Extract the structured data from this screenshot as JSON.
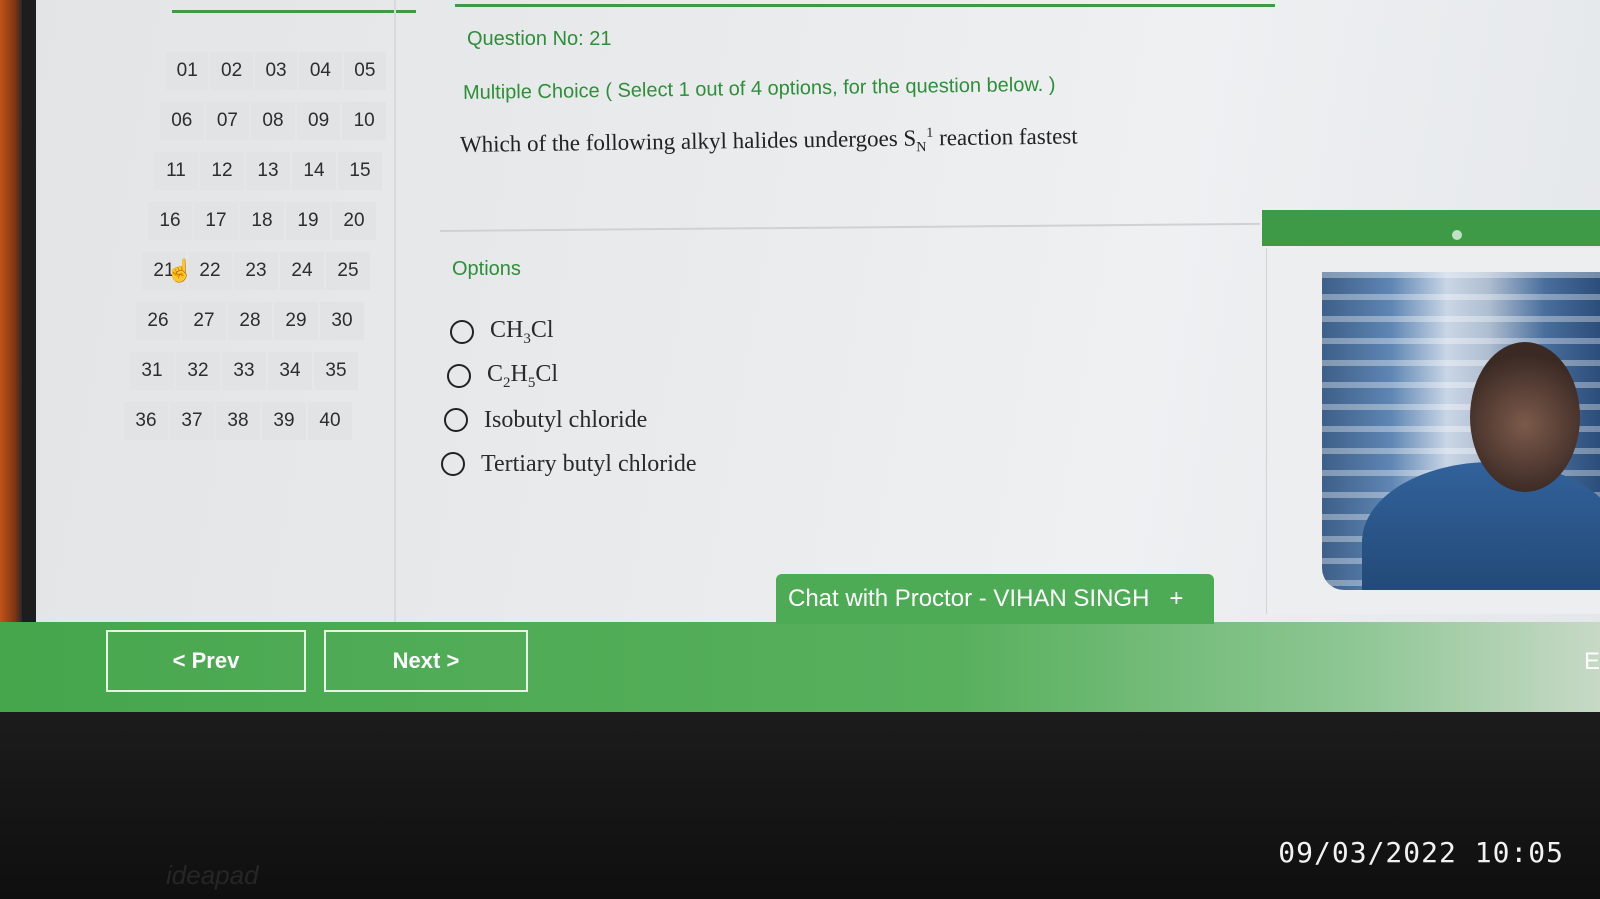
{
  "palette": {
    "rows": [
      [
        "01",
        "02",
        "03",
        "04",
        "05"
      ],
      [
        "06",
        "07",
        "08",
        "09",
        "10"
      ],
      [
        "11",
        "12",
        "13",
        "14",
        "15"
      ],
      [
        "16",
        "17",
        "18",
        "19",
        "20"
      ],
      [
        "21",
        "22",
        "23",
        "24",
        "25"
      ],
      [
        "26",
        "27",
        "28",
        "29",
        "30"
      ],
      [
        "31",
        "32",
        "33",
        "34",
        "35"
      ],
      [
        "36",
        "37",
        "38",
        "39",
        "40"
      ]
    ],
    "current": "21"
  },
  "question": {
    "number_label": "Question No: 21",
    "type_instruction": "Multiple Choice ( Select 1 out of 4 options, for the question below. )",
    "text_before": "Which of the following alkyl halides undergoes S",
    "text_sub": "N",
    "text_sup": "1",
    "text_after": " reaction fastest"
  },
  "options": {
    "label": "Options",
    "o1": {
      "a": "CH",
      "sub": "3",
      "b": "Cl"
    },
    "o2": {
      "a": "C",
      "sub1": "2",
      "b": "H",
      "sub2": "5",
      "c": "Cl"
    },
    "o3": "Isobutyl chloride",
    "o4": "Tertiary butyl chloride"
  },
  "chat": {
    "label": "Chat with Proctor - VIHAN SINGH",
    "plus": "+"
  },
  "nav": {
    "prev": "< Prev",
    "next": "Next >",
    "edge": "E"
  },
  "photo": {
    "timestamp": "09/03/2022 10:05",
    "brand": "ideapad"
  },
  "colors": {
    "accent": "#3e9a46",
    "text_green": "#2f8e3a"
  },
  "icons": {
    "cursor": "hand-pointer-icon"
  }
}
